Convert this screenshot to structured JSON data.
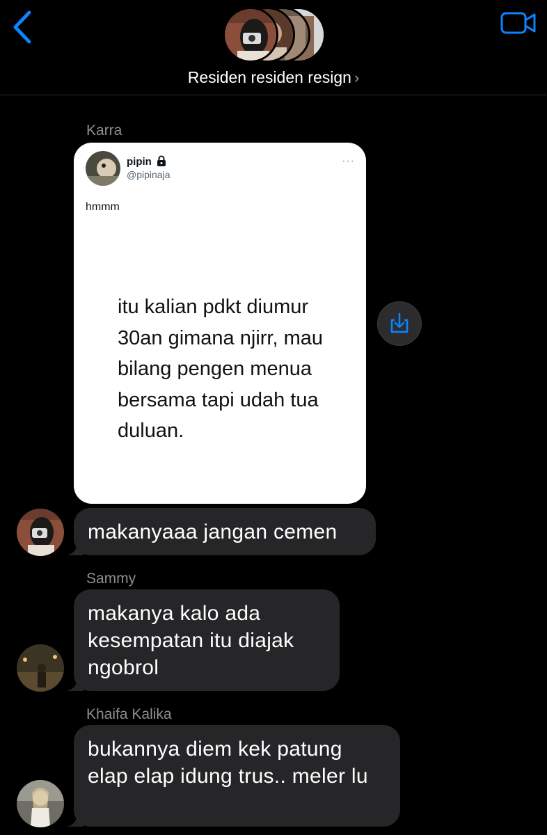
{
  "header": {
    "group_name": "Residen residen resign",
    "chevron": "›",
    "back_icon": "chevron-left-icon",
    "video_icon": "video-camera-icon",
    "accent_color": "#0a84ff"
  },
  "messages": [
    {
      "sender": "Karra",
      "type": "shared-tweet",
      "tweet": {
        "name": "pipin",
        "lock_icon": "lock-icon",
        "handle": "@pipinaja",
        "more": "···",
        "text": "hmmm",
        "image_text": "itu kalian pdkt diumur 30an gimana njirr, mau bilang pengen menua bersama tapi udah tua duluan."
      },
      "share_icon": "download-share-icon"
    },
    {
      "sender": "Karra",
      "type": "text",
      "text": "makanyaaa jangan cemen"
    },
    {
      "sender": "Sammy",
      "type": "text",
      "text": "makanya kalo ada kesempatan itu diajak ngobrol"
    },
    {
      "sender": "Khaifa Kalika",
      "type": "text",
      "text": "bukannya diem kek patung elap elap idung trus.. meler lu"
    }
  ]
}
